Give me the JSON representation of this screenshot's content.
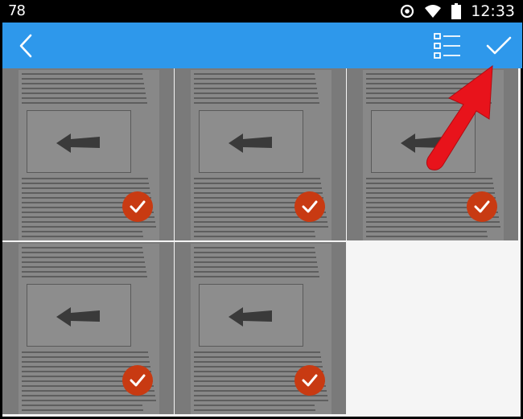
{
  "status_bar": {
    "notification_text": "78",
    "time": "12:33",
    "icons": [
      "data-saver-icon",
      "wifi-icon",
      "battery-icon"
    ]
  },
  "toolbar": {
    "color": "#2e98eb",
    "back_icon": "chevron-left-icon",
    "list_icon": "checklist-icon",
    "done_icon": "checkmark-icon"
  },
  "grid": {
    "columns": 3,
    "thumbnails": [
      {
        "selected": true
      },
      {
        "selected": true
      },
      {
        "selected": true
      },
      {
        "selected": true
      },
      {
        "selected": true
      }
    ],
    "check_color": "#c83a12"
  },
  "annotation": {
    "arrow_color": "#e8131b",
    "points_to": "done-button"
  }
}
